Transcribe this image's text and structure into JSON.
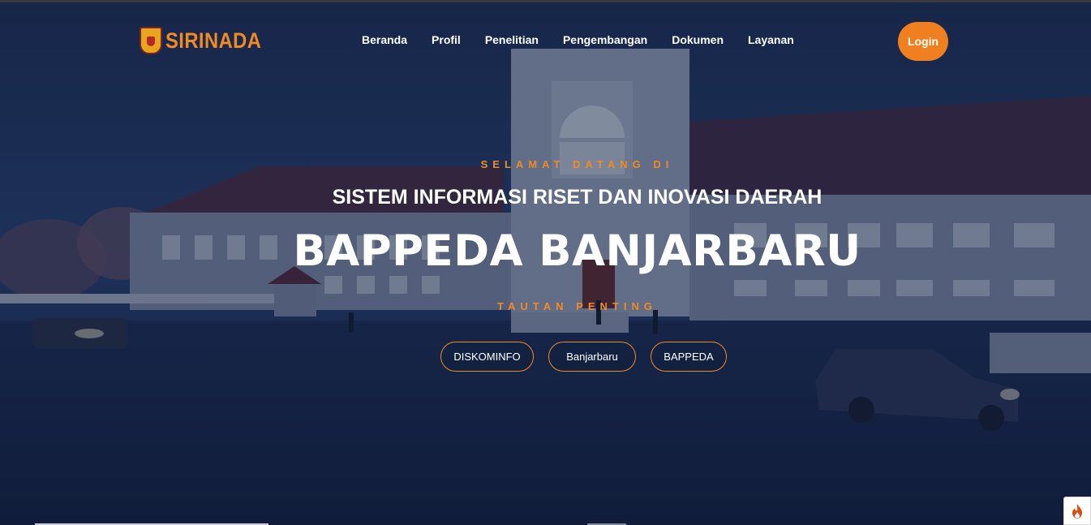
{
  "brand": {
    "name": "SIRINADA",
    "logo_icon": "bappeda-emblem-icon",
    "color": "#f08a24"
  },
  "nav": {
    "items": [
      {
        "label": "Beranda"
      },
      {
        "label": "Profil"
      },
      {
        "label": "Penelitian"
      },
      {
        "label": "Pengembangan"
      },
      {
        "label": "Dokumen"
      },
      {
        "label": "Layanan"
      }
    ],
    "login_label": "Login"
  },
  "hero": {
    "welcome": "SELAMAT DATANG DI",
    "subtitle": "SISTEM INFORMASI RISET DAN INOVASI DAERAH",
    "title": "BAPPEDA BANJARBARU",
    "links_label": "TAUTAN PENTING",
    "links": [
      {
        "label": "DISKOMINFO"
      },
      {
        "label": "Banjarbaru"
      },
      {
        "label": "BAPPEDA"
      }
    ]
  },
  "widget": {
    "icon": "flame-icon"
  },
  "colors": {
    "accent": "#f08a24",
    "background": "#14213d",
    "text": "#ffffff"
  }
}
